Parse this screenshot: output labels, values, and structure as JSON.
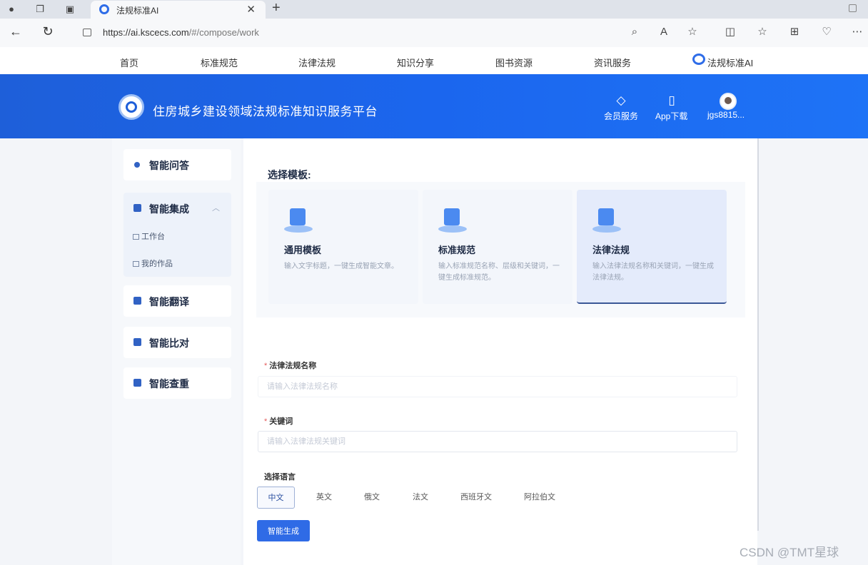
{
  "browser": {
    "tab_title": "法规标准AI",
    "url_host": "https://ai.kscecs.com",
    "url_path": "/#/compose/work"
  },
  "site_nav": {
    "items": [
      "首页",
      "标准规范",
      "法律法规",
      "知识分享",
      "图书资源",
      "资讯服务"
    ],
    "ai_label": "法规标准AI"
  },
  "banner": {
    "title": "住房城乡建设领域法规标准知识服务平台",
    "membership": "会员服务",
    "app_download": "App下载",
    "username": "jgs8815..."
  },
  "sidebar": {
    "qa": "智能问答",
    "integration": "智能集成",
    "sub_workbench": "工作台",
    "sub_works": "我的作品",
    "translate": "智能翻译",
    "compare": "智能比对",
    "dedup": "智能查重"
  },
  "templates": {
    "section_title": "选择模板:",
    "items": [
      {
        "name": "通用模板",
        "desc": "输入文字标题，一键生成智能文章。"
      },
      {
        "name": "标准规范",
        "desc": "输入标准规范名称、层级和关键词，一键生成标准规范。"
      },
      {
        "name": "法律法规",
        "desc": "输入法律法规名称和关键词，一键生成法律法规。"
      }
    ],
    "selected": "法律法规"
  },
  "form": {
    "name_label": "法律法规名称",
    "name_placeholder": "请输入法律法规名称",
    "keyword_label": "关键词",
    "keyword_placeholder": "请输入法律法规关键词",
    "lang_label": "选择语言",
    "languages": [
      "中文",
      "英文",
      "俄文",
      "法文",
      "西班牙文",
      "阿拉伯文"
    ],
    "selected_language": "中文",
    "submit": "智能生成"
  },
  "watermark": "CSDN @TMT星球",
  "colors": {
    "brand": "#1e66ee",
    "button": "#2f6be6",
    "accent_dark": "#3b5796"
  }
}
